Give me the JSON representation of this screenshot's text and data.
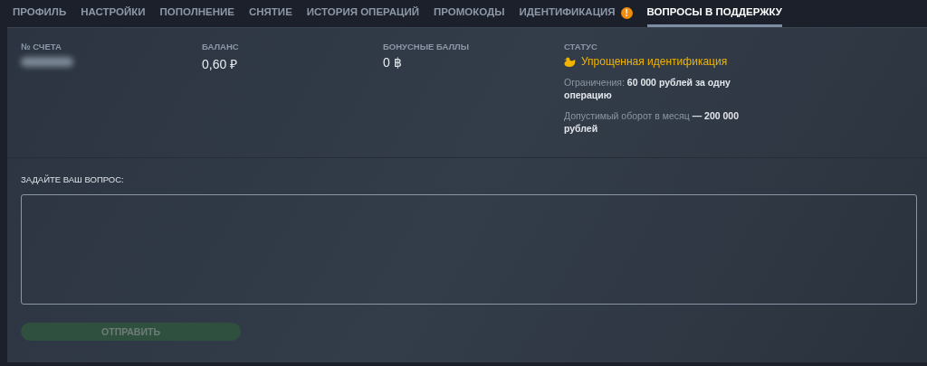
{
  "tabs": [
    {
      "label": "ПРОФИЛЬ",
      "selected": false,
      "alert": false
    },
    {
      "label": "НАСТРОЙКИ",
      "selected": false,
      "alert": false
    },
    {
      "label": "ПОПОЛНЕНИЕ",
      "selected": false,
      "alert": false
    },
    {
      "label": "СНЯТИЕ",
      "selected": false,
      "alert": false
    },
    {
      "label": "ИСТОРИЯ ОПЕРАЦИЙ",
      "selected": false,
      "alert": false
    },
    {
      "label": "ПРОМОКОДЫ",
      "selected": false,
      "alert": false
    },
    {
      "label": "ИДЕНТИФИКАЦИЯ",
      "selected": false,
      "alert": true
    },
    {
      "label": "ВОПРОСЫ В ПОДДЕРЖКУ",
      "selected": true,
      "alert": false
    }
  ],
  "alert_mark": "!",
  "account": {
    "label": "№ СЧЕТА",
    "redacted": true
  },
  "balance": {
    "label": "БАЛАНС",
    "value": "0,60 ₽"
  },
  "bonus": {
    "label": "БОНУСНЫЕ БАЛЛЫ",
    "value": "0 ฿"
  },
  "status": {
    "label": "СТАТУС",
    "value": "Упрощенная идентификация",
    "notes": [
      "Ограничения: **60 000 рублей за одну операцию**",
      "Допустимый оборот в месяц **— 200 000 рублей**"
    ]
  },
  "question": {
    "label": "ЗАДАЙТЕ ВАШ ВОПРОС:"
  },
  "submit": {
    "label": "ОТПРАВИТЬ",
    "disabled": true
  }
}
